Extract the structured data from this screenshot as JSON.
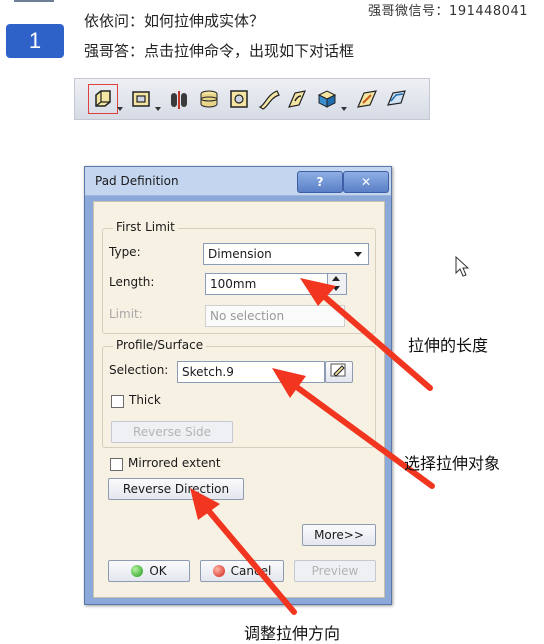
{
  "header": {
    "contact_text": "强哥微信号：191448041"
  },
  "step": {
    "number": "1"
  },
  "qa": {
    "question": "依依问：如何拉伸成实体？",
    "answer": "强哥答：点击拉伸命令，出现如下对话框"
  },
  "toolbar": {
    "icons": [
      "pad-icon",
      "pocket-icon",
      "shaft-icon",
      "groove-icon",
      "hole-icon",
      "rib-icon",
      "slot-icon",
      "solid-combine-icon",
      "stiffener-icon",
      "multi-section-solid-icon"
    ]
  },
  "dialog": {
    "title": "Pad Definition",
    "help_label": "?",
    "close_label": "✕",
    "first_limit": {
      "group_label": "First Limit",
      "type_label": "Type:",
      "type_value": "Dimension",
      "length_label": "Length:",
      "length_value": "100mm",
      "limit_label": "Limit:",
      "limit_placeholder": "No selection"
    },
    "profile": {
      "group_label": "Profile/Surface",
      "selection_label": "Selection:",
      "selection_value": "Sketch.9",
      "thick_label": "Thick",
      "reverse_side_label": "Reverse Side"
    },
    "mirrored_extent_label": "Mirrored extent",
    "reverse_direction_label": "Reverse Direction",
    "more_label": "More>>",
    "ok_label": "OK",
    "cancel_label": "Cancel",
    "preview_label": "Preview"
  },
  "annotations": {
    "length": "拉伸的长度",
    "selection": "选择拉伸对象",
    "direction": "调整拉伸方向"
  },
  "colors": {
    "step_badge": "#2f62c9",
    "arrow": "#f1351f",
    "dialog_frame": "#8aa9d8",
    "dialog_body": "#f7f1e4"
  }
}
